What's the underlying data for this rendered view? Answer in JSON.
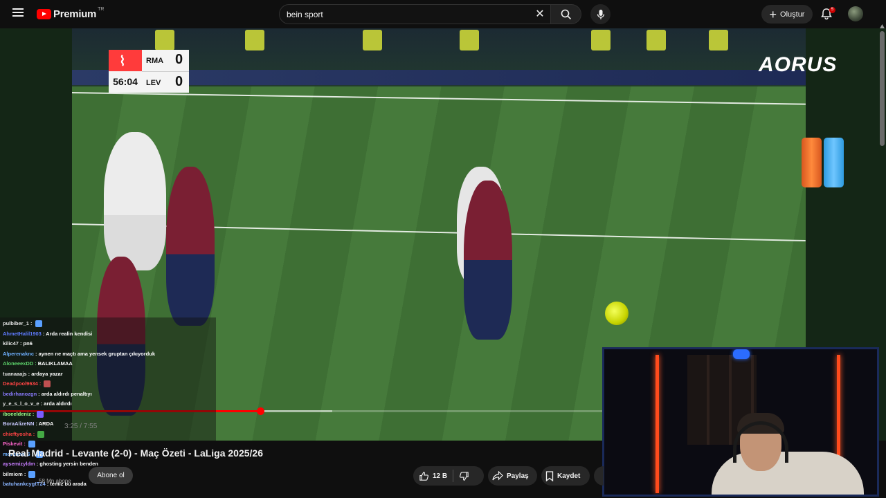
{
  "header": {
    "logo_text": "Premium",
    "logo_region": "TR",
    "search_value": "bein sport",
    "create_label": "Oluştur",
    "notification_count": "5"
  },
  "video": {
    "scoreboard": {
      "home_team": "RMA",
      "away_team": "LEV",
      "home_score": "0",
      "away_score": "0",
      "clock": "56:04"
    },
    "sponsor_text": "AORUS",
    "progress_fraction": 0.43,
    "buffer_fraction": 0.48,
    "time_display": "3:25 / 7:55"
  },
  "chat": [
    {
      "user": "pulbiber_1 :",
      "msg": "",
      "color": "#e6e6e6",
      "emote": "#5aa0ff"
    },
    {
      "user": "AhmetHalil1903",
      "msg": ": Arda realin kendisi",
      "color": "#5f7bff",
      "emote": ""
    },
    {
      "user": "kilic47 :",
      "msg": "pn6",
      "color": "#e6e6e6",
      "emote": ""
    },
    {
      "user": "Alperenaknc",
      "msg": ": aynen ne maçtı ama yensek gruptan çıkıyorduk",
      "color": "#6fb0ff",
      "emote": ""
    },
    {
      "user": "AloneeexDD :",
      "msg": "BALIKLAMAA",
      "color": "#5dd36b",
      "emote": ""
    },
    {
      "user": "tuanaaajs",
      "msg": ": ardaya yazar",
      "color": "#e6e6e6",
      "emote": ""
    },
    {
      "user": "Deadpool9634 :",
      "msg": "",
      "color": "#ff4444",
      "emote": "#c05050"
    },
    {
      "user": "bedirhanozgn",
      "msg": ": arda aldırdı penaltıyı",
      "color": "#8a7bff",
      "emote": ""
    },
    {
      "user": "y_e_s_l_o_v_e",
      "msg": ": arda aldırdı",
      "color": "#e6e6e6",
      "emote": ""
    },
    {
      "user": "iboeeldeniz :",
      "msg": "",
      "color": "#9dff8a",
      "emote": "#7a5cff"
    },
    {
      "user": "BoraAlizeNN",
      "msg": ": ARDA",
      "color": "#c9c9ff",
      "emote": ""
    },
    {
      "user": "chieftyosha :",
      "msg": "",
      "color": "#ff4444",
      "emote": "#44aa44"
    },
    {
      "user": "Piskevit :",
      "msg": "",
      "color": "#ff66cc",
      "emote": "#5aa0ff"
    },
    {
      "user": "montana_6 :",
      "msg": "",
      "color": "#6fb0ff",
      "emote": "#5aa0ff"
    },
    {
      "user": "aysemizyldm",
      "msg": ": ghosting yersin benden",
      "color": "#c77dff",
      "emote": ""
    },
    {
      "user": "bilmiom :",
      "msg": "",
      "color": "#e6e6e6",
      "emote": "#5aa0ff"
    },
    {
      "user": "batuhankcygtT24",
      "msg": ": temiz bu arada",
      "color": "#8ab4ff",
      "emote": ""
    }
  ],
  "below_video": {
    "title": "Real Madrid - Levante (2-0) - Maç Özeti - LaLiga 2025/26",
    "subscribers": "58 Mn abone",
    "subscribe_label": "Abone ol",
    "like_count": "12 B",
    "share_label": "Paylaş",
    "save_label": "Kaydet"
  },
  "colors": {
    "accent_red": "#ff0000",
    "background": "#0f0f0f",
    "pill": "#272727"
  }
}
